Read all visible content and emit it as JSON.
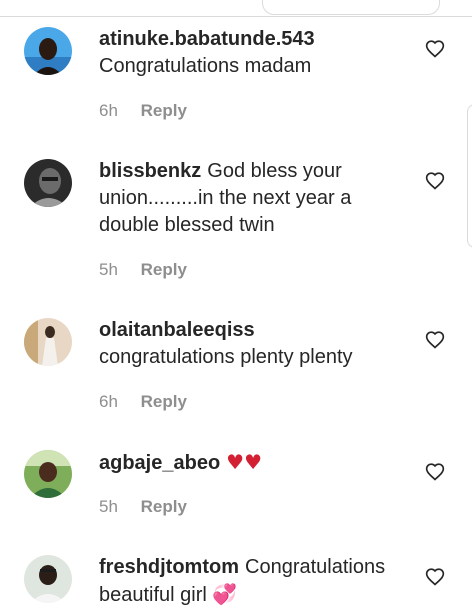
{
  "colors": {
    "text": "#262626",
    "secondary": "#8e8e8e",
    "divider": "#dbdbdb",
    "heart": "#d32033"
  },
  "comments": [
    {
      "username": "atinuke.babatunde.543",
      "text": "Congratulations madam",
      "emoji": "",
      "time": "6h",
      "reply_label": "Reply",
      "like_icon": "heart-outline-icon"
    },
    {
      "username": "blissbenkz",
      "text": "God bless your union.........in the next year a double blessed twin",
      "emoji": "",
      "time": "5h",
      "reply_label": "Reply",
      "like_icon": "heart-outline-icon"
    },
    {
      "username": "olaitanbaleeqiss",
      "text": "congratulations plenty plenty",
      "emoji": "",
      "time": "6h",
      "reply_label": "Reply",
      "like_icon": "heart-outline-icon"
    },
    {
      "username": "agbaje_abeo",
      "text": "",
      "emoji": "♥♥",
      "time": "5h",
      "reply_label": "Reply",
      "like_icon": "heart-outline-icon"
    },
    {
      "username": "freshdjtomtom",
      "text": "Congratulations beautiful girl",
      "emoji": "💞",
      "time": "",
      "reply_label": "",
      "like_icon": "heart-outline-icon"
    }
  ]
}
